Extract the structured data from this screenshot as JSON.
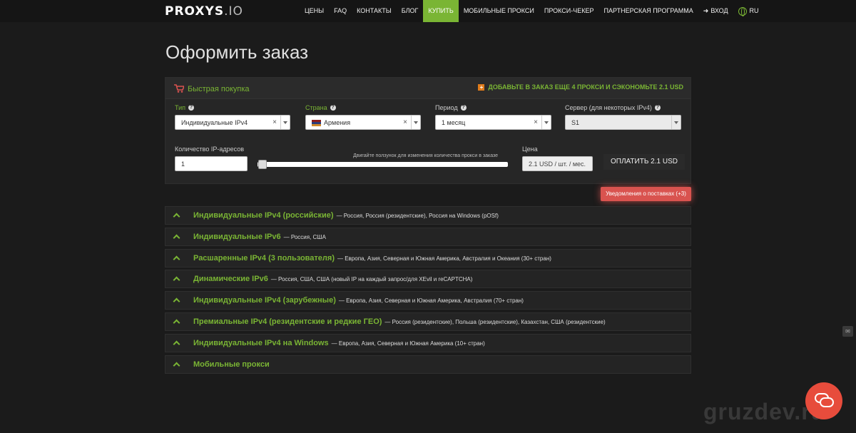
{
  "header": {
    "logo_bold": "PROXYS",
    "logo_light": ".IO",
    "nav": [
      "ЦЕНЫ",
      "FAQ",
      "КОНТАКТЫ",
      "БЛОГ",
      "КУПИТЬ",
      "МОБИЛЬНЫЕ ПРОКСИ",
      "ПРОКСИ-ЧЕКЕР",
      "ПАРТНЕРСКАЯ ПРОГРАММА"
    ],
    "login": "ВХОД",
    "lang": "RU"
  },
  "page_title": "Оформить заказ",
  "quick_buy": {
    "title": "Быстрая покупка",
    "promo": "ДОБАВЬТЕ В ЗАКАЗ ЕЩЕ 4 ПРОКСИ И СЭКОНОМЬТЕ 2.1 USD",
    "type_label": "Тип",
    "type_value": "Индивидуальные IPv4",
    "country_label": "Страна",
    "country_value": "Армения",
    "period_label": "Период",
    "period_value": "1 месяц",
    "server_label": "Сервер (для некоторых IPv4)",
    "server_value": "S1",
    "qty_label": "Количество IP-адресов",
    "qty_value": "1",
    "slider_hint": "Двигайте ползунок для изменения количества прокси в заказе",
    "price_label": "Цена",
    "price_value": "2.1 USD / шт. / мес.",
    "pay_button": "ОПЛАТИТЬ 2.1 USD"
  },
  "notify_button": "Уведомления о поставках (+3)",
  "sections": [
    {
      "title": "Индивидуальные IPv4 (российские)",
      "desc": "— Россия, Россия (резидентские), Россия на Windows (pOSf)"
    },
    {
      "title": "Индивидуальные IPv6",
      "desc": "— Россия, США"
    },
    {
      "title": "Расшаренные IPv4 (3 пользователя)",
      "desc": "— Европа, Азия, Северная и Южная Америка, Австралия и Океания (30+ стран)"
    },
    {
      "title": "Динамические IPv6",
      "desc": "— Россия, США, США (новый IP на каждый запрос/для XEvil и reCAPTCHA)"
    },
    {
      "title": "Индивидуальные IPv4 (зарубежные)",
      "desc": "— Европа, Азия, Северная и Южная Америка, Австралия (70+ стран)"
    },
    {
      "title": "Премиальные IPv4 (резидентские и редкие ГЕО)",
      "desc": "— Россия (резидентские), Польша (резидентские), Казахстан, США (резидентские)"
    },
    {
      "title": "Индивидуальные IPv4 на Windows",
      "desc": "— Европа, Азия, Северная и Южная Америка (10+ стран)"
    },
    {
      "title": "Мобильные прокси",
      "desc": ""
    }
  ],
  "watermark": "gruzdev.ru"
}
